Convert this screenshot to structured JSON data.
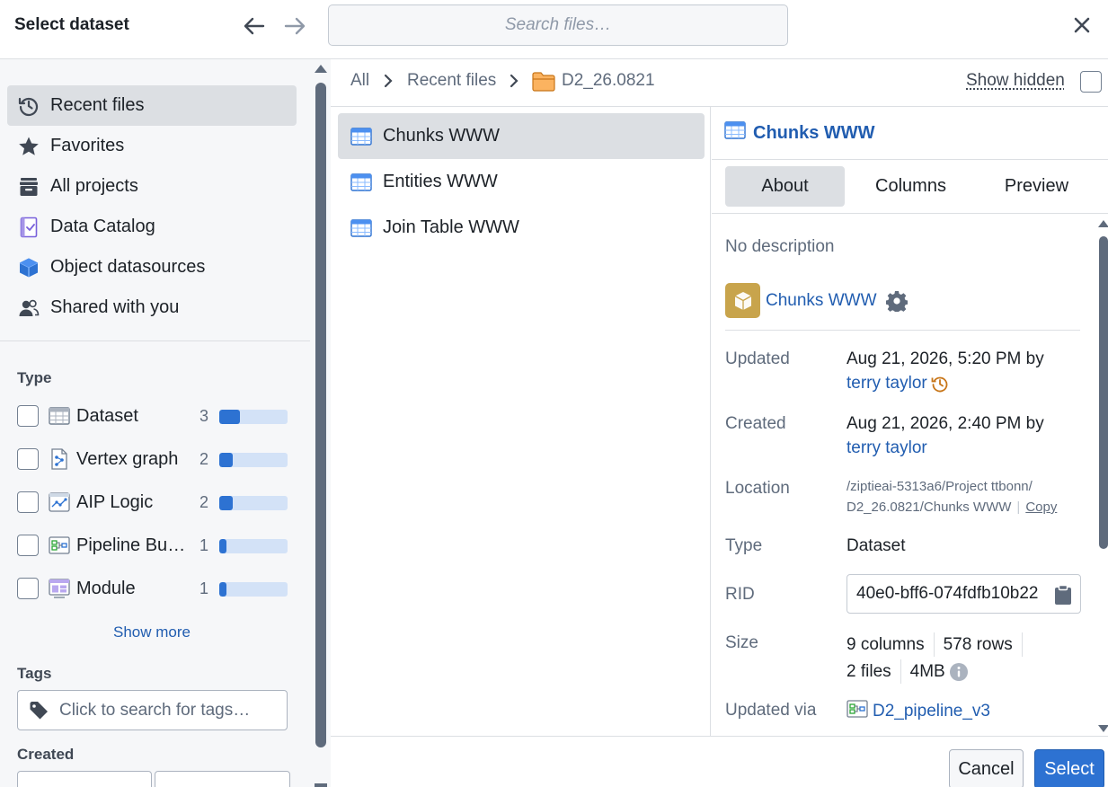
{
  "header": {
    "title": "Select dataset",
    "search_placeholder": "Search files…"
  },
  "sidebar": {
    "nav": [
      {
        "label": "Recent files",
        "icon": "history-icon",
        "active": true
      },
      {
        "label": "Favorites",
        "icon": "star-icon"
      },
      {
        "label": "All projects",
        "icon": "archive-icon"
      },
      {
        "label": "Data Catalog",
        "icon": "catalog-icon"
      },
      {
        "label": "Object datasources",
        "icon": "cube-icon"
      },
      {
        "label": "Shared with you",
        "icon": "people-icon"
      }
    ],
    "type_label": "Type",
    "types": [
      {
        "label": "Dataset",
        "count": "3",
        "share": 0.3,
        "icon": "dataset-icon"
      },
      {
        "label": "Vertex graph",
        "count": "2",
        "share": 0.2,
        "icon": "vertex-graph-icon"
      },
      {
        "label": "AIP Logic",
        "count": "2",
        "share": 0.2,
        "icon": "aip-logic-icon"
      },
      {
        "label": "Pipeline Builder",
        "count": "1",
        "share": 0.1,
        "icon": "pipeline-icon"
      },
      {
        "label": "Module",
        "count": "1",
        "share": 0.1,
        "icon": "module-icon"
      }
    ],
    "show_more": "Show more",
    "tags_label": "Tags",
    "tags_placeholder": "Click to search for tags…",
    "created_label": "Created"
  },
  "breadcrumb": {
    "items": [
      "All",
      "Recent files",
      "D2_26.0821"
    ],
    "show_hidden": "Show hidden"
  },
  "files": [
    {
      "label": "Chunks WWW",
      "active": true
    },
    {
      "label": "Entities WWW"
    },
    {
      "label": "Join Table WWW"
    }
  ],
  "details": {
    "title": "Chunks WWW",
    "tabs": [
      "About",
      "Columns",
      "Preview"
    ],
    "active_tab": "About",
    "description": "No description",
    "object_name": "Chunks WWW",
    "updated_label": "Updated",
    "updated_value": "Aug 21, 2026, 5:20 PM by",
    "updated_by": "terry taylor",
    "created_label": "Created",
    "created_value": "Aug 21, 2026, 2:40 PM by",
    "created_by": "terry taylor",
    "location_label": "Location",
    "location_line1": "/ziptieai-5313a6/Project ttbonn/",
    "location_line2": "D2_26.0821/Chunks WWW",
    "copy_label": "Copy",
    "type_label": "Type",
    "type_value": "Dataset",
    "rid_label": "RID",
    "rid_value": "40e0-bff6-074fdfb10b22",
    "size_label": "Size",
    "size_columns": "9 columns",
    "size_rows": "578 rows",
    "size_files": "2 files",
    "size_bytes": "4MB",
    "updated_via_label": "Updated via",
    "updated_via_value": "D2_pipeline_v3"
  },
  "footer": {
    "cancel": "Cancel",
    "select": "Select"
  },
  "colors": {
    "accent": "#2d72d2",
    "link": "#215db0",
    "object_badge": "#c8a44c"
  }
}
